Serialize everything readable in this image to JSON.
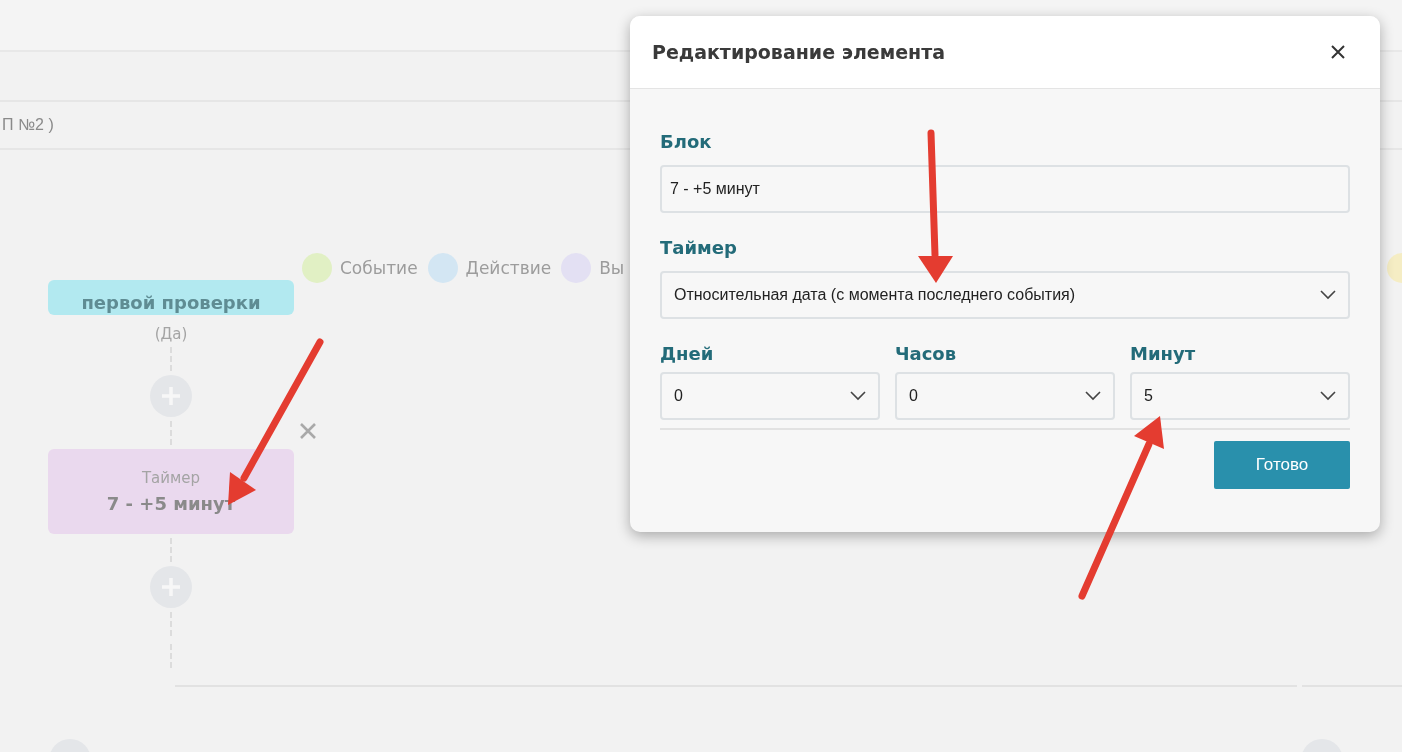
{
  "header": {
    "breadcrumb": "П №2 )"
  },
  "legend": [
    {
      "label": "Событие",
      "color": "#e1f0c4"
    },
    {
      "label": "Действие",
      "color": "#d3e6f3"
    },
    {
      "label": "Вы",
      "color": "#e3e0f3"
    }
  ],
  "legend_edge_dot": {
    "color": "#f5edc4"
  },
  "flow": [
    {
      "kind": "block",
      "title": "первой проверки",
      "color": "#b2e9f0"
    },
    {
      "kind": "branch",
      "label": "(Да)"
    },
    {
      "kind": "add"
    },
    {
      "kind": "timer",
      "label": "Таймер",
      "title": "7 - +5 минут",
      "color": "#ead9ee"
    },
    {
      "kind": "add"
    }
  ],
  "modal": {
    "title": "Редактирование элемента",
    "block": {
      "label": "Блок",
      "value": "7 - +5 минут"
    },
    "timer": {
      "label": "Таймер",
      "value": "Относительная дата (с момента последнего события)"
    },
    "durations": [
      {
        "label": "Дней",
        "value": "0"
      },
      {
        "label": "Часов",
        "value": "0"
      },
      {
        "label": "Минут",
        "value": "5"
      }
    ],
    "button": "Готово"
  }
}
